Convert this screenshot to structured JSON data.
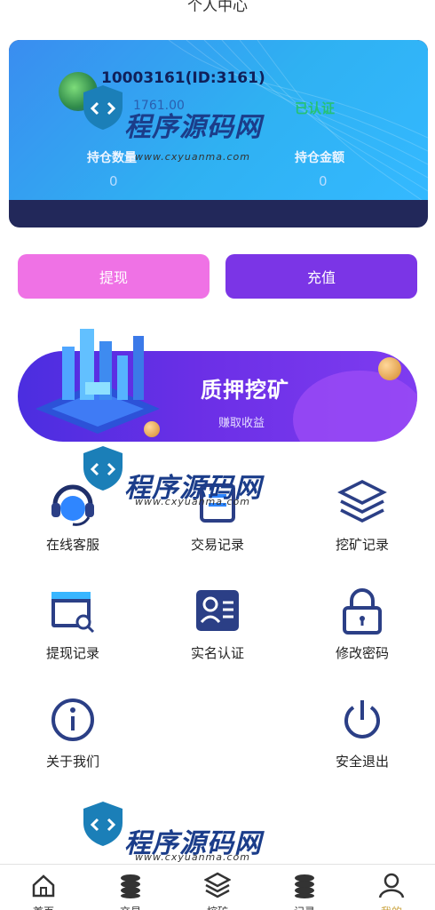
{
  "header": {
    "title": "个人中心"
  },
  "profile": {
    "user_id": "10003161(ID:3161)",
    "balance": "1761.00",
    "verified": "已认证",
    "holding_qty_label": "持仓数量",
    "holding_qty_value": "0",
    "holding_amount_label": "持仓金额",
    "holding_amount_value": "0"
  },
  "actions": {
    "withdraw": "提现",
    "recharge": "充值"
  },
  "banner": {
    "title": "质押挖矿",
    "subtitle": "赚取收益"
  },
  "menu": [
    {
      "label": "在线客服",
      "icon": "headset-icon"
    },
    {
      "label": "交易记录",
      "icon": "ledger-icon"
    },
    {
      "label": "挖矿记录",
      "icon": "layers-icon"
    },
    {
      "label": "提现记录",
      "icon": "card-icon"
    },
    {
      "label": "实名认证",
      "icon": "id-card-icon"
    },
    {
      "label": "修改密码",
      "icon": "lock-icon"
    },
    {
      "label": "关于我们",
      "icon": "info-icon"
    },
    {
      "label": "安全退出",
      "icon": "power-icon"
    }
  ],
  "watermark": {
    "brand": "程序源码网",
    "url": "www.cxyuanma.com"
  },
  "tabs": [
    {
      "label": "首页",
      "icon": "home-icon"
    },
    {
      "label": "交易",
      "icon": "coins-icon"
    },
    {
      "label": "挖矿",
      "icon": "layers-icon"
    },
    {
      "label": "记录",
      "icon": "coins-icon"
    },
    {
      "label": "我的",
      "icon": "user-icon",
      "active": true
    }
  ],
  "colors": {
    "withdraw_button": "#ef72e5",
    "recharge_button": "#7b35e6",
    "verified": "#26c275",
    "active_tab": "#c9a13a"
  }
}
